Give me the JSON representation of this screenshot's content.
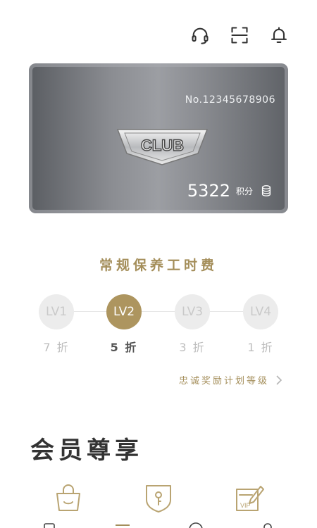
{
  "header": {
    "icons": [
      "headset-icon",
      "scan-icon",
      "bell-icon"
    ]
  },
  "card": {
    "number": "No.12345678906",
    "logo_text": "CLUB",
    "points": "5322",
    "points_unit": "积分",
    "coin_icon": "coin-stack-icon"
  },
  "benefit": {
    "title": "常规保养工时费",
    "levels": [
      {
        "label": "LV1",
        "discount": "7 折",
        "active": false
      },
      {
        "label": "LV2",
        "discount": "5 折",
        "active": true
      },
      {
        "label": "LV3",
        "discount": "3 折",
        "active": false
      },
      {
        "label": "LV4",
        "discount": "1 折",
        "active": false
      }
    ]
  },
  "loyalty_link": "忠诚奖励计划等级",
  "section": {
    "title": "会员尊享",
    "icons": [
      "shopping-bag-icon",
      "shield-key-icon",
      "vip-card-icon"
    ]
  },
  "colors": {
    "gold": "#a48e5a",
    "active_level": "#ad955f"
  }
}
